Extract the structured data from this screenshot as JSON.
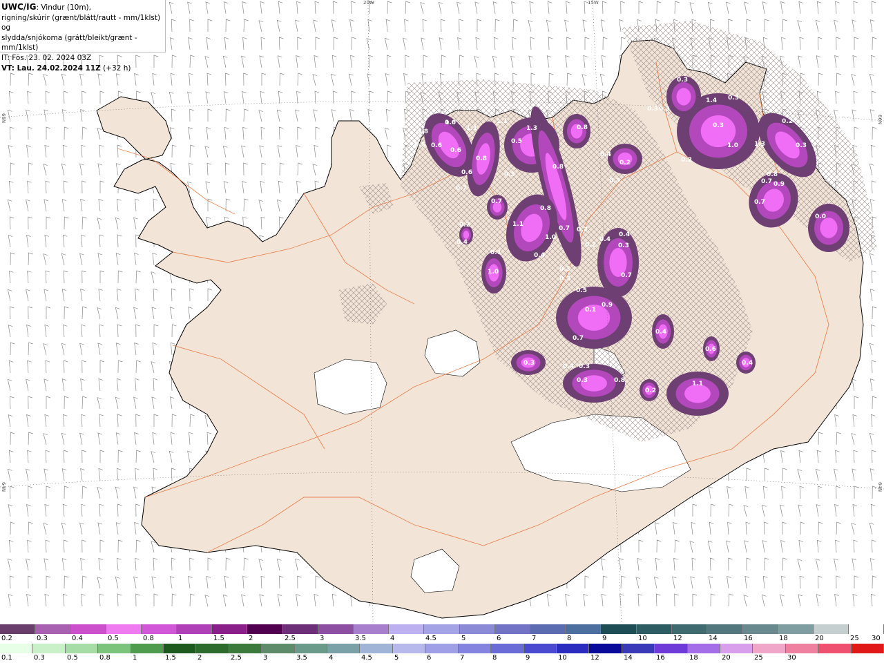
{
  "header": {
    "model": "UWC/IG",
    "line1_rest": ": Vindur (10m),",
    "line2": "rigning/skúrir (grænt/blátt/rautt - mm/1klst) og",
    "line3": "slydda/snjókoma (grátt/bleikt/grænt - mm/1klst)",
    "it": "IT: Fös. 23. 02. 2024 03Z",
    "vt_label": "VT: Lau. 24.02.2024 11Z",
    "vt_offset": " (+32 h)"
  },
  "graticule": {
    "top_labels": [
      "20W",
      "15W"
    ],
    "left_labels": [
      "66N",
      "64N"
    ],
    "right_labels": [
      "66N",
      "64N"
    ]
  },
  "precip_labels": [
    "1.0",
    "1.1",
    "0.8",
    "0.5",
    "0.6",
    "0.6",
    "0.6",
    "0.8",
    "0.7",
    "1.1",
    "1.3",
    "0.5",
    "0.8",
    "0.8",
    "0.5",
    "0.4",
    "0.2",
    "0.3",
    "0.3",
    "0.3",
    "0.3",
    "0.7",
    "1.0",
    "0.2",
    "0.4",
    "0.8",
    "0.2",
    "1.1",
    "1.0",
    "0.1",
    "0.7",
    "0.4",
    "0.2",
    "0.3",
    "0.4",
    "0.4",
    "0.3",
    "0.3",
    "0.7",
    "0.5",
    "0.9",
    "0.1",
    "0.7",
    "0.3",
    "0.4",
    "0.3",
    "0.3",
    "0.8",
    "0.4",
    "0.6",
    "0.4",
    "0.2",
    "1.1",
    "0.2",
    "0.3",
    "0.3",
    "1.0",
    "1.3",
    "0.9",
    "0.7",
    "0.2",
    "0.3",
    "0.8",
    "0.7",
    "0.0",
    "1.4",
    "0.6"
  ],
  "colors": {
    "land": "#f2e4d7",
    "sea": "#ffffff",
    "glacier": "#ffffff",
    "roads": "#e8743c",
    "snow_dark": "#6e3f72",
    "snow_mid": "#b348bd",
    "snow_light": "#f06ef5",
    "barb": "#8a8a8a"
  },
  "scale_snow": {
    "colors": [
      "#6a3f6e",
      "#a860b0",
      "#cc4fcc",
      "#f07af0",
      "#d257d8",
      "#b040b8",
      "#8a1f8a",
      "#520050",
      "#6c2f78",
      "#8d4fa2",
      "#a77fcc",
      "#bdb0f0",
      "#a3a3e6",
      "#8a8ad6",
      "#7272c6",
      "#5b6cb0",
      "#4d6fa0",
      "#1f4d55",
      "#2e5c63",
      "#3f6a70",
      "#52787d",
      "#688a8e",
      "#7f9ea1",
      "#c5cfd0",
      "#ffffff"
    ],
    "labels": [
      "0.2",
      "0.3",
      "0.4",
      "0.5",
      "0.8",
      "1",
      "1.5",
      "2",
      "2.5",
      "3",
      "3.5",
      "4",
      "4.5",
      "5",
      "6",
      "7",
      "8",
      "9",
      "10",
      "12",
      "14",
      "16",
      "18",
      "20",
      "25",
      "30"
    ]
  },
  "scale_rain": {
    "colors": [
      "#e6ffe6",
      "#c9f0c9",
      "#a6dca6",
      "#7cc47c",
      "#4f9c4f",
      "#1e5a1e",
      "#2c6b2c",
      "#3b7a3b",
      "#5e8c6a",
      "#6a9a8a",
      "#7aa0a8",
      "#9fb4d6",
      "#b7b9ec",
      "#9f9fe8",
      "#8484e0",
      "#6b6bd8",
      "#4a4ad0",
      "#2b2bc0",
      "#0a0a9a",
      "#3a3ab8",
      "#6e3ad8",
      "#a46ee8",
      "#d8a0ec",
      "#f0a6c8",
      "#f080a0",
      "#f05070",
      "#e01818"
    ],
    "labels": [
      "0.1",
      "0.3",
      "0.5",
      "0.8",
      "1",
      "1.5",
      "2",
      "2.5",
      "3",
      "3.5",
      "4",
      "4.5",
      "5",
      "6",
      "7",
      "8",
      "9",
      "10",
      "12",
      "14",
      "16",
      "18",
      "20",
      "25",
      "30"
    ]
  }
}
